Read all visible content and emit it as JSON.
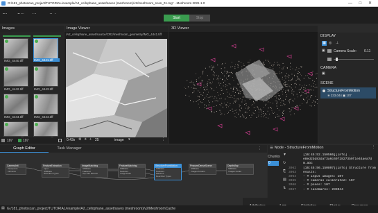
{
  "window": {
    "title": "G:/181_photoscan_project/TUTORIAL/example/A2_cellophane_asset/saves (meshroom)/v2/meshroom_scan_01.mg* - Meshroom 2021.1.0"
  },
  "menu": [
    "File",
    "Edit",
    "View",
    "Help"
  ],
  "toolbar": {
    "start_label": "Start",
    "stop_label": "Stop"
  },
  "images_panel": {
    "title": "Images",
    "items": [
      "IMG_4440.tiff",
      "IMG_4441.tiff",
      "IMG_4442.tiff",
      "IMG_4443.tiff",
      "IMG_4444.tiff",
      "IMG_4444.tiff",
      "IMG_4445.tiff",
      "IMG_4446.tiff",
      "IMG_4447.tiff",
      "IMG_4448.tiff"
    ],
    "count": "107",
    "count2": "107"
  },
  "image_viewer": {
    "title": "Image Viewer",
    "path": "/A2_cellophane_asset/source/CR2/meshroom_geometry/IMG_4441.tiff",
    "zoom": "0.43x",
    "select_value": "image",
    "page": "25"
  },
  "viewer3d": {
    "title": "3D Viewer"
  },
  "display": {
    "title": "DISPLAY",
    "camera_scale_label": "Camera Scale:",
    "camera_scale_value": "0.11",
    "camera_title": "CAMERA",
    "scene_title": "SCENE",
    "scene_item": "StructureFromMotion",
    "scene_stats_a": "233,044",
    "scene_stats_b": "107"
  },
  "tabs": {
    "graph_editor": "Graph Editor",
    "task_manager": "Task Manager"
  },
  "graph": {
    "nodes": [
      {
        "title": "CameraInit",
        "ports": [
          "Viewpoints",
          "Intrinsics"
        ]
      },
      {
        "title": "FeatureExtraction",
        "ports": [
          "Input",
          "SfMData",
          "Describer Types"
        ]
      },
      {
        "title": "ImageMatching",
        "ports": [
          "SfMData",
          "Features",
          "Top Pair Results"
        ]
      },
      {
        "title": "FeatureMatching",
        "ports": [
          "SfMData",
          "Features",
          "Image Pairs"
        ]
      },
      {
        "title": "StructureFromMotion",
        "ports": [
          "SfMData",
          "Features",
          "Matches",
          "Describer Types"
        ]
      },
      {
        "title": "PrepareDenseScene",
        "ports": [
          "SfMData",
          "Images Folders"
        ]
      },
      {
        "title": "DepthMap",
        "ports": [
          "SfMData",
          "Images Folder"
        ]
      }
    ]
  },
  "node_panel": {
    "title": "Node - StructureFromMotion",
    "chunks_label": "Chunks",
    "chunk_index": "0",
    "line_numbers": [
      "",
      "",
      "",
      "3062",
      "3063",
      "3064",
      "3065",
      "3066",
      "3067"
    ],
    "log": [
      "[16:45:52.150566][info] ...",
      "e8ed2bd83daf3a6c69728273b0f1e44aea7d",
      "m.abc",
      "[16:45:56.150807][info] Structure from Motion r",
      "esults:",
      "     - # input images: 107",
      "     - # cameras calibrated: 107",
      "     - # poses: 107",
      "     - # landmarks: 233044"
    ],
    "tabs": [
      "Attributes",
      "Log",
      "Statistics",
      "Status",
      "Documen..."
    ]
  },
  "statusbar": {
    "path": "G:/181_photoscan_project/TUTORIAL/example/A2_cellophane_asset/saves (meshroom)/v2/MeshroomCache"
  },
  "colors": {
    "accent_green": "#3a9c4f",
    "selection_blue": "#3b8fd6"
  }
}
